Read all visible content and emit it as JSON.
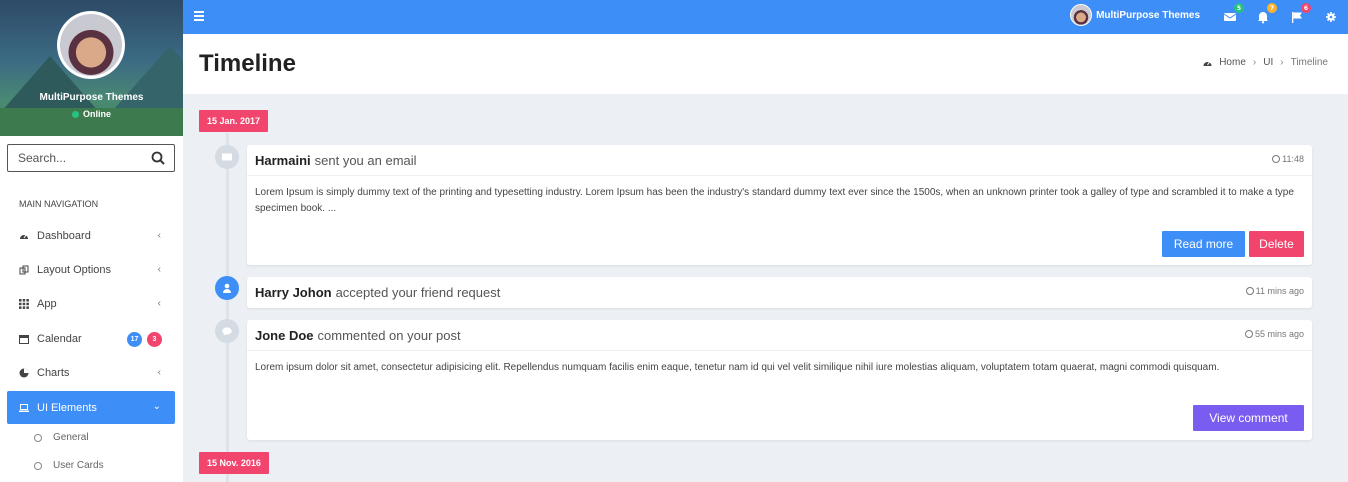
{
  "sidebar": {
    "user_name": "MultiPurpose Themes",
    "user_status": "Online",
    "search_placeholder": "Search...",
    "nav_header": "MAIN NAVIGATION",
    "items": [
      {
        "label": "Dashboard"
      },
      {
        "label": "Layout Options"
      },
      {
        "label": "App"
      },
      {
        "label": "Calendar",
        "badges": [
          "17",
          "3"
        ]
      },
      {
        "label": "Charts"
      },
      {
        "label": "UI Elements"
      }
    ],
    "sub_items": [
      {
        "label": "General"
      },
      {
        "label": "User Cards"
      }
    ]
  },
  "topbar": {
    "user_name": "MultiPurpose Themes",
    "badges": {
      "messages": "5",
      "notifications": "7",
      "flags": "6"
    }
  },
  "header": {
    "title": "Timeline",
    "breadcrumb": [
      "Home",
      "UI",
      "Timeline"
    ]
  },
  "timeline": {
    "labels": [
      "15 Jan. 2017",
      "15 Nov. 2016"
    ],
    "items": [
      {
        "name": "Harmaini",
        "action": "sent you an email",
        "time": "11:48",
        "body": "Lorem Ipsum is simply dummy text of the printing and typesetting industry. Lorem Ipsum has been the industry's standard dummy text ever since the 1500s, when an unknown printer took a galley of type and scrambled it to make a type specimen book. ...",
        "buttons": [
          "Read more",
          "Delete"
        ]
      },
      {
        "name": "Harry Johon",
        "action": "accepted your friend request",
        "time": "11 mins ago"
      },
      {
        "name": "Jone Doe",
        "action": "commented on your post",
        "time": "55 mins ago",
        "body": "Lorem ipsum dolor sit amet, consectetur adipisicing elit. Repellendus numquam facilis enim eaque, tenetur nam id qui vel velit similique nihil iure molestias aliquam, voluptatem totam quaerat, magni commodi quisquam.",
        "buttons": [
          "View comment"
        ]
      }
    ]
  },
  "colors": {
    "primary": "#3e8ef7",
    "danger": "#f2456e",
    "purple": "#7a5cf0",
    "success": "#26c281"
  }
}
